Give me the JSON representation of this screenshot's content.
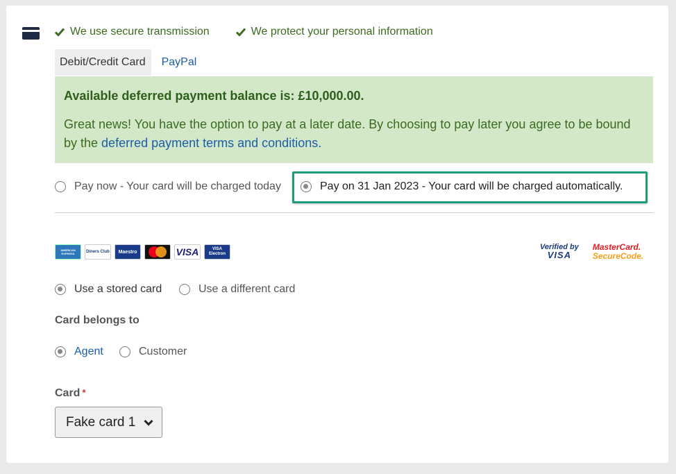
{
  "secure": {
    "items": [
      "We use secure transmission",
      "We protect your personal information"
    ],
    "check_color": "#3a6b1f"
  },
  "tabs": [
    {
      "label": "Debit/Credit Card",
      "active": true
    },
    {
      "label": "PayPal",
      "active": false
    }
  ],
  "notice": {
    "title": "Available deferred payment balance is: £10,000.00.",
    "text_before": "Great news! You have the option to pay at a later date. By choosing to pay later you agree to be bound by the ",
    "link": "deferred payment terms and conditions.",
    "background": "#d3e8c9"
  },
  "payment_timing": {
    "pay_now": "Pay now - Your card will be charged today",
    "pay_later": "Pay on 31 Jan 2023 - Your card will be charged automatically.",
    "selected": "pay_later",
    "highlight_color": "#1d9c7a"
  },
  "card_logos": [
    "amex-icon",
    "diners-club-icon",
    "maestro-icon",
    "mastercard-icon",
    "visa-icon",
    "visa-electron-icon"
  ],
  "logo_text": {
    "amex": "AMERICAN EXPRESS",
    "diners": "Diners Club",
    "maestro": "Maestro",
    "visa": "VISA",
    "visa_electron": "VISA Electron"
  },
  "secure_logos": {
    "vbv_line1": "Verified by",
    "vbv_line2": "VISA",
    "mc_line1": "MasterCard.",
    "mc_line2": "SecureCode."
  },
  "card_choice": {
    "stored": "Use a stored card",
    "different": "Use a different card",
    "selected": "stored"
  },
  "card_belongs": {
    "label": "Card belongs to",
    "agent": "Agent",
    "customer": "Customer",
    "selected": "agent"
  },
  "card_select": {
    "label": "Card",
    "required_mark": "*",
    "value": "Fake card 1"
  }
}
